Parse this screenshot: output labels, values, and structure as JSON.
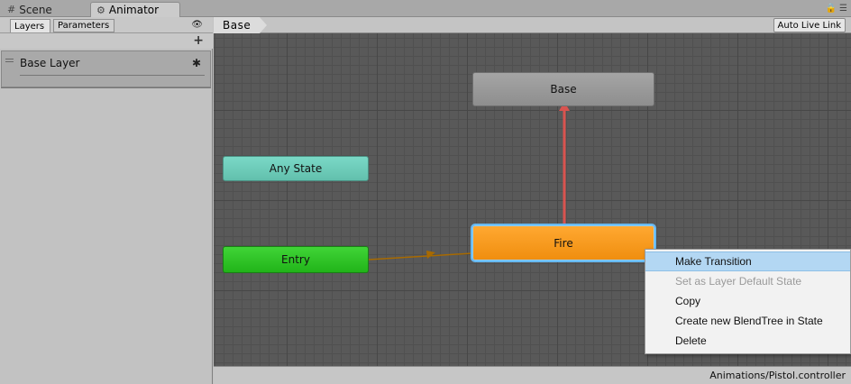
{
  "tabs": {
    "scene_label": "Scene",
    "animator_label": "Animator"
  },
  "left_panel": {
    "layers_tab": "Layers",
    "parameters_tab": "Parameters",
    "layer_name": "Base Layer"
  },
  "graph": {
    "breadcrumb": "Base",
    "live_link_button": "Auto Live Link",
    "states": {
      "base": "Base",
      "any_state": "Any State",
      "entry": "Entry",
      "fire": "Fire"
    },
    "colors": {
      "transition_selected": "#d9534f",
      "transition_default": "#a86a00",
      "fire_state": "#f29a1f",
      "entry_state": "#2ec626",
      "any_state": "#6fcdb9",
      "selection_outline": "#67b9f2"
    }
  },
  "status": {
    "controller_path": "Animations/Pistol.controller"
  },
  "context_menu": {
    "items": [
      "Make Transition",
      "Set as Layer Default State",
      "Copy",
      "Create new BlendTree in State",
      "Delete"
    ]
  }
}
